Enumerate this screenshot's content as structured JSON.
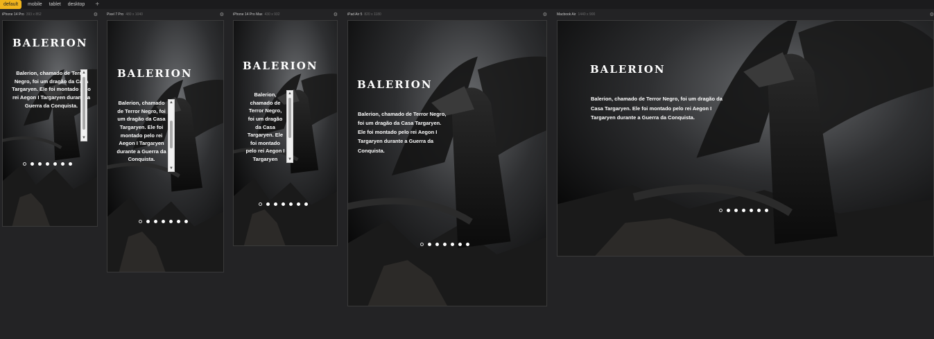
{
  "tabs": [
    "default",
    "mobile",
    "tablet",
    "desktop"
  ],
  "add_label": "+",
  "devices": [
    {
      "name": "iPhone 14 Pro",
      "dims": "393 x 852"
    },
    {
      "name": "Pixel 7 Pro",
      "dims": "480 x 1040"
    },
    {
      "name": "iPhone 14 Pro Max",
      "dims": "430 x 932"
    },
    {
      "name": "iPad Air 5",
      "dims": "820 x 1180"
    },
    {
      "name": "Macbook Air",
      "dims": "1440 x 900"
    }
  ],
  "site": {
    "title": "BALERION",
    "description": "Balerion, chamado de Terror Negro, foi um dragão da Casa Targaryen. Ele foi montado pelo rei Aegon I Targaryen durante a Guerra da Conquista."
  },
  "dots_count": 7,
  "colors": {
    "accent_tab": "#f0b41c",
    "background": "#232325"
  }
}
